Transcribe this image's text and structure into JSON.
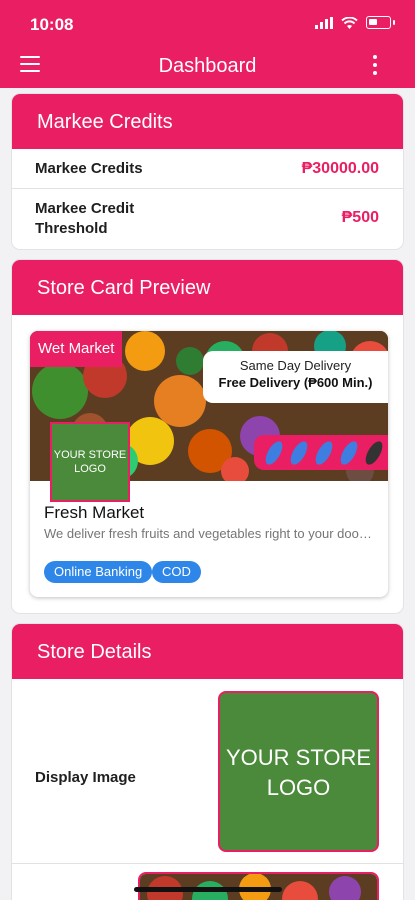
{
  "status_bar": {
    "time": "10:08"
  },
  "header": {
    "title": "Dashboard"
  },
  "credits": {
    "heading": "Markee Credits",
    "rows": [
      {
        "label": "Markee Credits",
        "value": "₱30000.00"
      },
      {
        "label": "Markee Credit Threshold",
        "value": "₱500"
      }
    ]
  },
  "preview": {
    "heading": "Store Card Preview",
    "category_tag": "Wet Market",
    "delivery_line1": "Same Day Delivery",
    "delivery_line2": "Free Delivery (₱600 Min.)",
    "logo_text": "YOUR STORE LOGO",
    "store_name": "Fresh Market",
    "store_description": "We deliver fresh fruits and vegetables right to your doorstep",
    "payment_chips": [
      "Online Banking",
      "COD"
    ]
  },
  "store_details": {
    "heading": "Store Details",
    "display_image_label": "Display Image",
    "logo_text": "YOUR STORE LOGO"
  },
  "colors": {
    "accent": "#e91e63",
    "logo_green": "#4a8a3a",
    "chip_blue": "#2e86e8"
  }
}
